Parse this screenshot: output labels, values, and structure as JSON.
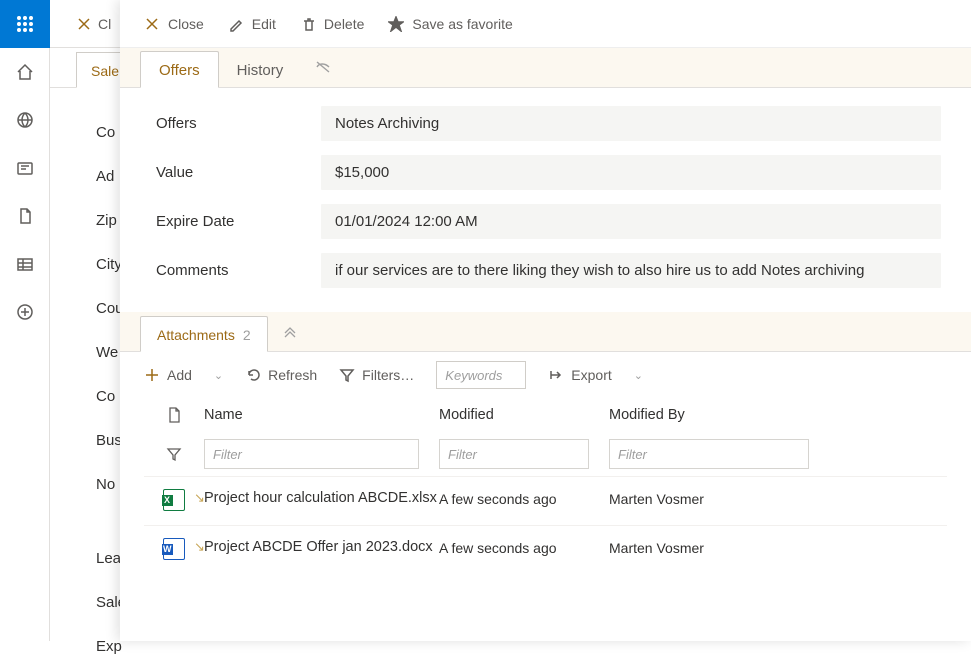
{
  "rail": {
    "icons": [
      "apps",
      "home",
      "globe",
      "news",
      "file",
      "table",
      "plus"
    ]
  },
  "background": {
    "toolbar_close_prefix": "Cl",
    "tab_sales_prefix": "Sale",
    "labels": [
      "Co",
      "Ad",
      "Zip",
      "City",
      "Cou",
      "We",
      "Co",
      "Bus",
      "No"
    ],
    "lower_labels": [
      "Lea",
      "Sale",
      "Exp"
    ]
  },
  "panel": {
    "toolbar": {
      "close": "Close",
      "edit": "Edit",
      "delete": "Delete",
      "favorite": "Save as favorite"
    },
    "tabs": {
      "offers": "Offers",
      "history": "History"
    },
    "form": {
      "offers": {
        "label": "Offers",
        "value": "Notes Archiving"
      },
      "value": {
        "label": "Value",
        "value": "$15,000"
      },
      "expire": {
        "label": "Expire Date",
        "value": "01/01/2024 12:00 AM"
      },
      "comments": {
        "label": "Comments",
        "value": "if our services are to there liking they wish to also hire us to add Notes archiving"
      }
    },
    "attachments": {
      "tab_label": "Attachments",
      "count": "2",
      "toolbar": {
        "add": "Add",
        "refresh": "Refresh",
        "filters": "Filters…",
        "keywords_ph": "Keywords",
        "export": "Export"
      },
      "columns": {
        "name": "Name",
        "modified": "Modified",
        "modified_by": "Modified By"
      },
      "filter_ph": "Filter",
      "rows": [
        {
          "type": "excel",
          "name": "Project hour calculation ABCDE.xlsx",
          "modified": "A few seconds ago",
          "by": "Marten Vosmer"
        },
        {
          "type": "word",
          "name": "Project ABCDE Offer jan 2023.docx",
          "modified": "A few seconds ago",
          "by": "Marten Vosmer"
        }
      ]
    }
  }
}
